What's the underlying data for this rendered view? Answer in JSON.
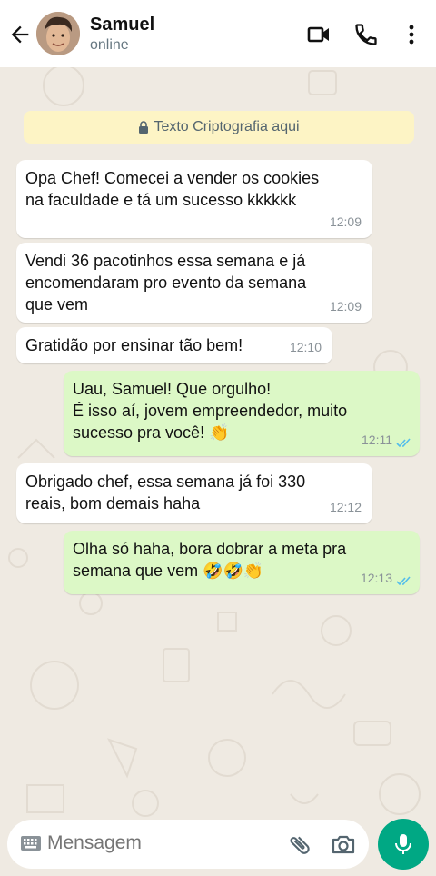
{
  "contact": {
    "name": "Samuel",
    "status": "online"
  },
  "encryption_notice": "Texto Criptografia aqui",
  "messages": [
    {
      "direction": "in",
      "text": "Opa Chef! Comecei a vender os cookies\nna faculdade e tá um sucesso kkkkkk",
      "time": "12:09"
    },
    {
      "direction": "in",
      "text": "Vendi 36 pacotinhos essa semana e já\nencomendaram pro evento da semana\nque vem",
      "time": "12:09"
    },
    {
      "direction": "in",
      "text": "Gratidão por ensinar tão bem!",
      "time": "12:10"
    },
    {
      "direction": "out",
      "text": "Uau, Samuel! Que orgulho!\nÉ isso aí, jovem empreendedor, muito\nsucesso pra você! 👏",
      "time": "12:11",
      "read": true
    },
    {
      "direction": "in",
      "text": "Obrigado chef, essa semana já foi 330\nreais, bom demais haha",
      "time": "12:12"
    },
    {
      "direction": "out",
      "text": "Olha só haha, bora dobrar a meta pra\nsemana que vem 🤣🤣👏",
      "time": "12:13",
      "read": true
    }
  ],
  "input": {
    "placeholder": "Mensagem"
  },
  "colors": {
    "incoming": "#ffffff",
    "outgoing": "#dcf8c6",
    "accent": "#00a884",
    "read_ticks": "#53bdeb"
  },
  "icons": [
    "back-arrow-icon",
    "video-call-icon",
    "phone-icon",
    "more-options-icon",
    "lock-icon",
    "keyboard-icon",
    "attach-icon",
    "camera-icon",
    "mic-icon"
  ]
}
